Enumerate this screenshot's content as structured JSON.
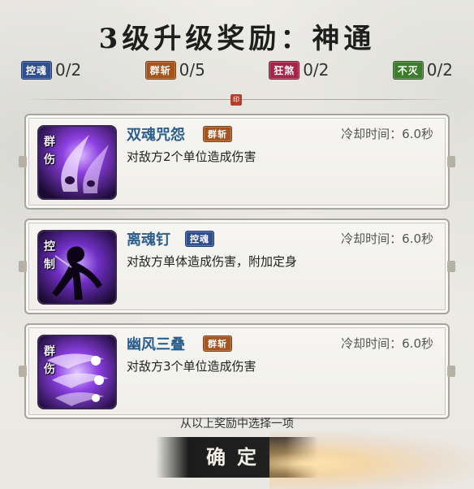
{
  "title": "3级升级奖励：神通",
  "counters": [
    {
      "tag": "控魂",
      "value": "0/2",
      "color": "#2f4f8f"
    },
    {
      "tag": "群斩",
      "value": "0/5",
      "color": "#a4541c"
    },
    {
      "tag": "狂煞",
      "value": "0/2",
      "color": "#a82447"
    },
    {
      "tag": "不灭",
      "value": "0/2",
      "color": "#3f7b2e"
    }
  ],
  "seal": "印",
  "skills": [
    {
      "vertical_tag": [
        "群",
        "伤"
      ],
      "name": "双魂咒怨",
      "tag": "群斩",
      "tag_color": "#a4541c",
      "cooldown": "冷却时间：6.0秒",
      "desc": "对敌方2个单位造成伤害",
      "icon": "twin-spirit-icon"
    },
    {
      "vertical_tag": [
        "控",
        "制"
      ],
      "name": "离魂钉",
      "tag": "控魂",
      "tag_color": "#2f4f8f",
      "cooldown": "冷却时间：6.0秒",
      "desc": "对敌方单体造成伤害，附加定身",
      "icon": "nailed-figure-icon"
    },
    {
      "vertical_tag": [
        "群",
        "伤"
      ],
      "name": "幽风三叠",
      "tag": "群斩",
      "tag_color": "#a4541c",
      "cooldown": "冷却时间：6.0秒",
      "desc": "对敌方3个单位造成伤害",
      "icon": "triple-ghost-icon"
    }
  ],
  "hint": "从以上奖励中选择一项",
  "confirm_label": "确定"
}
